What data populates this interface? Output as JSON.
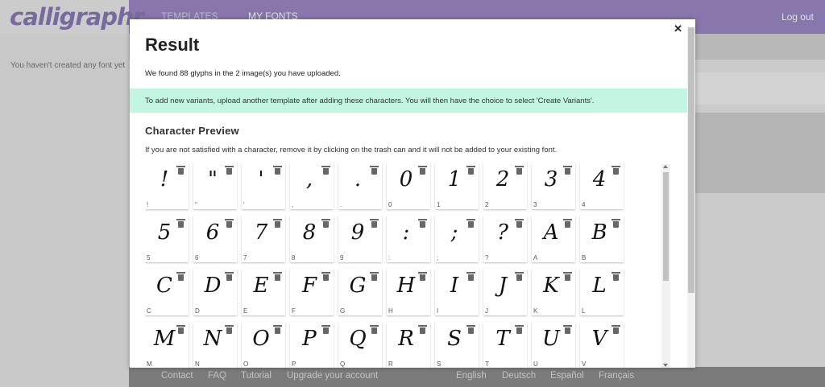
{
  "app": {
    "logo": "calligraphr",
    "nav": [
      "TEMPLATES",
      "MY FONTS"
    ],
    "logout": "Log out",
    "sidebar_empty": "You haven't created any font yet",
    "footer_links": [
      "Contact",
      "FAQ",
      "Tutorial",
      "Upgrade your account"
    ],
    "languages": [
      "English",
      "Deutsch",
      "Español",
      "Français"
    ]
  },
  "modal": {
    "title": "Result",
    "found_text": "We found 88 glyphs in the 2 image(s) you have uploaded.",
    "info_text": "To add new variants, upload another template after adding these characters. You will then have the choice to select 'Create Variants'.",
    "preview_title": "Character Preview",
    "preview_desc": "If you are not satisfied with a character, remove it by clicking on the trash can and it will not be added to your existing font.",
    "close_icon": "close-icon",
    "glyphs": [
      {
        "char": "!",
        "label": "!"
      },
      {
        "char": "\"",
        "label": "\""
      },
      {
        "char": "'",
        "label": "'"
      },
      {
        "char": ",",
        "label": ","
      },
      {
        "char": ".",
        "label": "."
      },
      {
        "char": "0",
        "label": "0"
      },
      {
        "char": "1",
        "label": "1"
      },
      {
        "char": "2",
        "label": "2"
      },
      {
        "char": "3",
        "label": "3"
      },
      {
        "char": "4",
        "label": "4"
      },
      {
        "char": "5",
        "label": "5"
      },
      {
        "char": "6",
        "label": "6"
      },
      {
        "char": "7",
        "label": "7"
      },
      {
        "char": "8",
        "label": "8"
      },
      {
        "char": "9",
        "label": "9"
      },
      {
        "char": ":",
        "label": ":"
      },
      {
        "char": ";",
        "label": ";"
      },
      {
        "char": "?",
        "label": "?"
      },
      {
        "char": "A",
        "label": "A"
      },
      {
        "char": "B",
        "label": "B"
      },
      {
        "char": "C",
        "label": "C"
      },
      {
        "char": "D",
        "label": "D"
      },
      {
        "char": "E",
        "label": "E"
      },
      {
        "char": "F",
        "label": "F"
      },
      {
        "char": "G",
        "label": "G"
      },
      {
        "char": "H",
        "label": "H"
      },
      {
        "char": "I",
        "label": "I"
      },
      {
        "char": "J",
        "label": "J"
      },
      {
        "char": "K",
        "label": "K"
      },
      {
        "char": "L",
        "label": "L"
      },
      {
        "char": "M",
        "label": "M"
      },
      {
        "char": "N",
        "label": "N"
      },
      {
        "char": "O",
        "label": "O"
      },
      {
        "char": "P",
        "label": "P"
      },
      {
        "char": "Q",
        "label": "Q"
      },
      {
        "char": "R",
        "label": "R"
      },
      {
        "char": "S",
        "label": "S"
      },
      {
        "char": "T",
        "label": "T"
      },
      {
        "char": "U",
        "label": "U"
      },
      {
        "char": "V",
        "label": "V"
      }
    ]
  },
  "colors": {
    "header": "#9b88c4",
    "info_bar": "#c3f5e3",
    "footer": "#8d8d8d"
  }
}
